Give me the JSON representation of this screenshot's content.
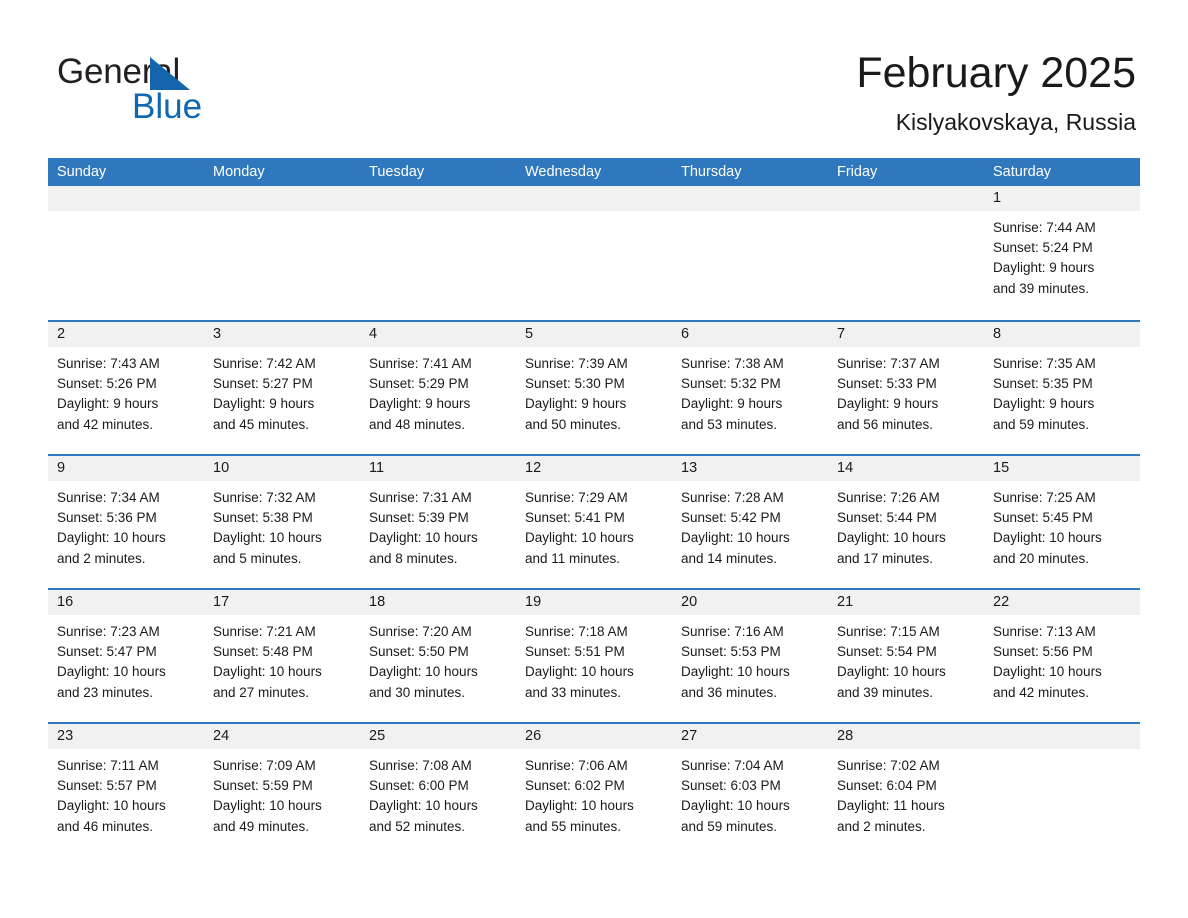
{
  "brand": {
    "name_part1": "General",
    "name_part2": "Blue"
  },
  "header": {
    "title": "February 2025",
    "subtitle": "Kislyakovskaya, Russia"
  },
  "colors": {
    "header_blue": "#2f78bd",
    "logo_blue": "#1068b0",
    "daynum_band": "#f1f1f1",
    "text": "#1a1a1a"
  },
  "weekday_headers": [
    "Sunday",
    "Monday",
    "Tuesday",
    "Wednesday",
    "Thursday",
    "Friday",
    "Saturday"
  ],
  "weeks": [
    [
      {
        "empty": true
      },
      {
        "empty": true
      },
      {
        "empty": true
      },
      {
        "empty": true
      },
      {
        "empty": true
      },
      {
        "empty": true
      },
      {
        "day": "1",
        "sunrise": "Sunrise: 7:44 AM",
        "sunset": "Sunset: 5:24 PM",
        "daylight_line1": "Daylight: 9 hours",
        "daylight_line2": "and 39 minutes."
      }
    ],
    [
      {
        "day": "2",
        "sunrise": "Sunrise: 7:43 AM",
        "sunset": "Sunset: 5:26 PM",
        "daylight_line1": "Daylight: 9 hours",
        "daylight_line2": "and 42 minutes."
      },
      {
        "day": "3",
        "sunrise": "Sunrise: 7:42 AM",
        "sunset": "Sunset: 5:27 PM",
        "daylight_line1": "Daylight: 9 hours",
        "daylight_line2": "and 45 minutes."
      },
      {
        "day": "4",
        "sunrise": "Sunrise: 7:41 AM",
        "sunset": "Sunset: 5:29 PM",
        "daylight_line1": "Daylight: 9 hours",
        "daylight_line2": "and 48 minutes."
      },
      {
        "day": "5",
        "sunrise": "Sunrise: 7:39 AM",
        "sunset": "Sunset: 5:30 PM",
        "daylight_line1": "Daylight: 9 hours",
        "daylight_line2": "and 50 minutes."
      },
      {
        "day": "6",
        "sunrise": "Sunrise: 7:38 AM",
        "sunset": "Sunset: 5:32 PM",
        "daylight_line1": "Daylight: 9 hours",
        "daylight_line2": "and 53 minutes."
      },
      {
        "day": "7",
        "sunrise": "Sunrise: 7:37 AM",
        "sunset": "Sunset: 5:33 PM",
        "daylight_line1": "Daylight: 9 hours",
        "daylight_line2": "and 56 minutes."
      },
      {
        "day": "8",
        "sunrise": "Sunrise: 7:35 AM",
        "sunset": "Sunset: 5:35 PM",
        "daylight_line1": "Daylight: 9 hours",
        "daylight_line2": "and 59 minutes."
      }
    ],
    [
      {
        "day": "9",
        "sunrise": "Sunrise: 7:34 AM",
        "sunset": "Sunset: 5:36 PM",
        "daylight_line1": "Daylight: 10 hours",
        "daylight_line2": "and 2 minutes."
      },
      {
        "day": "10",
        "sunrise": "Sunrise: 7:32 AM",
        "sunset": "Sunset: 5:38 PM",
        "daylight_line1": "Daylight: 10 hours",
        "daylight_line2": "and 5 minutes."
      },
      {
        "day": "11",
        "sunrise": "Sunrise: 7:31 AM",
        "sunset": "Sunset: 5:39 PM",
        "daylight_line1": "Daylight: 10 hours",
        "daylight_line2": "and 8 minutes."
      },
      {
        "day": "12",
        "sunrise": "Sunrise: 7:29 AM",
        "sunset": "Sunset: 5:41 PM",
        "daylight_line1": "Daylight: 10 hours",
        "daylight_line2": "and 11 minutes."
      },
      {
        "day": "13",
        "sunrise": "Sunrise: 7:28 AM",
        "sunset": "Sunset: 5:42 PM",
        "daylight_line1": "Daylight: 10 hours",
        "daylight_line2": "and 14 minutes."
      },
      {
        "day": "14",
        "sunrise": "Sunrise: 7:26 AM",
        "sunset": "Sunset: 5:44 PM",
        "daylight_line1": "Daylight: 10 hours",
        "daylight_line2": "and 17 minutes."
      },
      {
        "day": "15",
        "sunrise": "Sunrise: 7:25 AM",
        "sunset": "Sunset: 5:45 PM",
        "daylight_line1": "Daylight: 10 hours",
        "daylight_line2": "and 20 minutes."
      }
    ],
    [
      {
        "day": "16",
        "sunrise": "Sunrise: 7:23 AM",
        "sunset": "Sunset: 5:47 PM",
        "daylight_line1": "Daylight: 10 hours",
        "daylight_line2": "and 23 minutes."
      },
      {
        "day": "17",
        "sunrise": "Sunrise: 7:21 AM",
        "sunset": "Sunset: 5:48 PM",
        "daylight_line1": "Daylight: 10 hours",
        "daylight_line2": "and 27 minutes."
      },
      {
        "day": "18",
        "sunrise": "Sunrise: 7:20 AM",
        "sunset": "Sunset: 5:50 PM",
        "daylight_line1": "Daylight: 10 hours",
        "daylight_line2": "and 30 minutes."
      },
      {
        "day": "19",
        "sunrise": "Sunrise: 7:18 AM",
        "sunset": "Sunset: 5:51 PM",
        "daylight_line1": "Daylight: 10 hours",
        "daylight_line2": "and 33 minutes."
      },
      {
        "day": "20",
        "sunrise": "Sunrise: 7:16 AM",
        "sunset": "Sunset: 5:53 PM",
        "daylight_line1": "Daylight: 10 hours",
        "daylight_line2": "and 36 minutes."
      },
      {
        "day": "21",
        "sunrise": "Sunrise: 7:15 AM",
        "sunset": "Sunset: 5:54 PM",
        "daylight_line1": "Daylight: 10 hours",
        "daylight_line2": "and 39 minutes."
      },
      {
        "day": "22",
        "sunrise": "Sunrise: 7:13 AM",
        "sunset": "Sunset: 5:56 PM",
        "daylight_line1": "Daylight: 10 hours",
        "daylight_line2": "and 42 minutes."
      }
    ],
    [
      {
        "day": "23",
        "sunrise": "Sunrise: 7:11 AM",
        "sunset": "Sunset: 5:57 PM",
        "daylight_line1": "Daylight: 10 hours",
        "daylight_line2": "and 46 minutes."
      },
      {
        "day": "24",
        "sunrise": "Sunrise: 7:09 AM",
        "sunset": "Sunset: 5:59 PM",
        "daylight_line1": "Daylight: 10 hours",
        "daylight_line2": "and 49 minutes."
      },
      {
        "day": "25",
        "sunrise": "Sunrise: 7:08 AM",
        "sunset": "Sunset: 6:00 PM",
        "daylight_line1": "Daylight: 10 hours",
        "daylight_line2": "and 52 minutes."
      },
      {
        "day": "26",
        "sunrise": "Sunrise: 7:06 AM",
        "sunset": "Sunset: 6:02 PM",
        "daylight_line1": "Daylight: 10 hours",
        "daylight_line2": "and 55 minutes."
      },
      {
        "day": "27",
        "sunrise": "Sunrise: 7:04 AM",
        "sunset": "Sunset: 6:03 PM",
        "daylight_line1": "Daylight: 10 hours",
        "daylight_line2": "and 59 minutes."
      },
      {
        "day": "28",
        "sunrise": "Sunrise: 7:02 AM",
        "sunset": "Sunset: 6:04 PM",
        "daylight_line1": "Daylight: 11 hours",
        "daylight_line2": "and 2 minutes."
      },
      {
        "empty": true
      }
    ]
  ]
}
